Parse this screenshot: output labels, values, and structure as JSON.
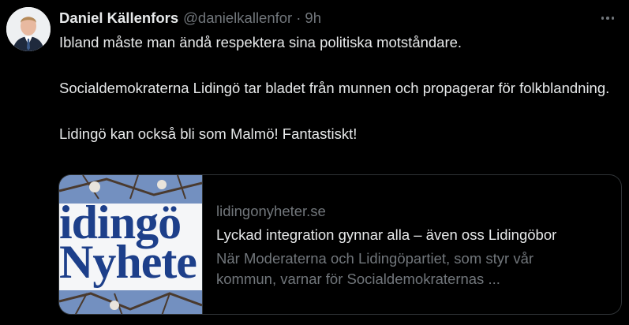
{
  "tweet": {
    "author_name": "Daniel Källenfors",
    "author_handle": "@danielkallenfor",
    "separator": "·",
    "time": "9h",
    "lines": [
      "Ibland måste man ändå respektera sina politiska motståndare.",
      "Socialdemokraterna Lidingö tar bladet från munnen och propagerar för folkblandning.",
      "Lidingö kan också bli som Malmö! Fantastiskt!"
    ]
  },
  "card": {
    "image_logo_line1": "idingö",
    "image_logo_line2": "Nyhete",
    "domain": "lidingonyheter.se",
    "title": "Lyckad integration gynnar alla – även oss Lidingöbor",
    "description": "När Moderaterna och Lidingöpartiet, som styr vår kommun, varnar för Socialdemokraternas ..."
  },
  "icons": {
    "more": "more-horizontal-icon",
    "avatar": "profile-photo"
  },
  "colors": {
    "background": "#000000",
    "text_primary": "#e7e9ea",
    "text_secondary": "#71767b",
    "border": "#2f3336",
    "logo_blue": "#1d3f8a"
  }
}
